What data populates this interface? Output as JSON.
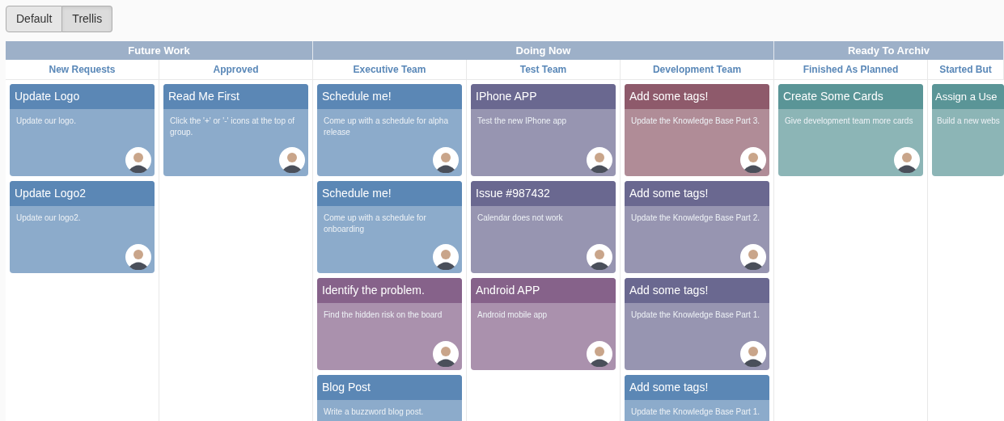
{
  "view_buttons": [
    {
      "label": "Default",
      "selected": false
    },
    {
      "label": "Trellis",
      "selected": true
    }
  ],
  "groups": [
    {
      "title": "Future Work",
      "columns": [
        {
          "title": "New Requests",
          "cards": [
            {
              "title": "Update Logo",
              "text": "Update our logo.",
              "color": "#5b87b5",
              "avatar": true
            },
            {
              "title": "Update Logo2",
              "text": "Update our logo2.",
              "color": "#5b87b5",
              "avatar": true
            }
          ]
        },
        {
          "title": "Approved",
          "cards": [
            {
              "title": "Read Me First",
              "text": "Click the '+' or '-' icons at the top of group.",
              "color": "#5b87b5",
              "avatar": true
            }
          ]
        }
      ]
    },
    {
      "title": "Doing Now",
      "columns": [
        {
          "title": "Executive Team",
          "cards": [
            {
              "title": "Schedule me!",
              "text": "Come up with a schedule for alpha release",
              "color": "#5b87b5",
              "avatar": true
            },
            {
              "title": "Schedule me!",
              "text": "Come up with a schedule for onboarding",
              "color": "#5b87b5",
              "avatar": true
            },
            {
              "title": "Identify the problem.",
              "text": "Find the hidden risk on the board",
              "color": "#86628a",
              "avatar": true
            },
            {
              "title": "Blog Post",
              "text": "Write a buzzword blog post.",
              "color": "#5b87b5",
              "avatar": false
            }
          ]
        },
        {
          "title": "Test Team",
          "cards": [
            {
              "title": "IPhone APP",
              "text": "Test the new IPhone app",
              "color": "#6a6890",
              "avatar": true
            },
            {
              "title": "Issue #987432",
              "text": "Calendar does not work",
              "color": "#6a6890",
              "avatar": true
            },
            {
              "title": "Android APP",
              "text": "Android mobile app",
              "color": "#86628a",
              "avatar": true
            }
          ]
        },
        {
          "title": "Development Team",
          "cards": [
            {
              "title": "Add some tags!",
              "text": "Update the Knowledge Base Part 3.",
              "color": "#8e5a6b",
              "avatar": true
            },
            {
              "title": "Add some tags!",
              "text": "Update the Knowledge Base Part 2.",
              "color": "#6a6890",
              "avatar": true
            },
            {
              "title": "Add some tags!",
              "text": "Update the Knowledge Base Part 1.",
              "color": "#6a6890",
              "avatar": true
            },
            {
              "title": "Add some tags!",
              "text": "Update the Knowledge Base Part 1.",
              "color": "#5b87b5",
              "avatar": false
            }
          ]
        }
      ]
    },
    {
      "title": "Ready To Archiv",
      "columns": [
        {
          "title": "Finished As Planned",
          "cards": [
            {
              "title": "Create Some Cards",
              "text": "Give development team more cards",
              "color": "#5a9597",
              "avatar": true
            }
          ]
        },
        {
          "title": "Started But",
          "cards": [
            {
              "title": "Assign a Use",
              "text": "Build a new webs",
              "color": "#5a9597",
              "avatar": false
            }
          ]
        }
      ]
    }
  ]
}
